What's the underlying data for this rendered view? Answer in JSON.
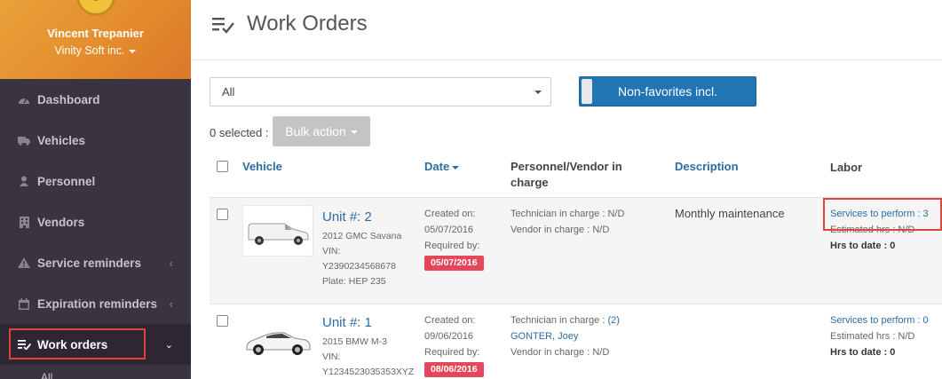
{
  "sidebar": {
    "user_name": "Vincent Trepanier",
    "company": "Vinity Soft inc.",
    "items": [
      {
        "label": "Dashboard",
        "icon": "dashboard-icon"
      },
      {
        "label": "Vehicles",
        "icon": "truck-icon"
      },
      {
        "label": "Personnel",
        "icon": "user-icon"
      },
      {
        "label": "Vendors",
        "icon": "building-icon"
      },
      {
        "label": "Service reminders",
        "icon": "warning-icon"
      },
      {
        "label": "Expiration reminders",
        "icon": "calendar-icon"
      },
      {
        "label": "Work orders",
        "icon": "checklist-icon"
      }
    ],
    "sub_all": "All"
  },
  "header": {
    "title": "Work Orders"
  },
  "filters": {
    "select_value": "All",
    "toggle_label": "Non-favorites incl."
  },
  "bulk": {
    "selected_text": "0 selected :",
    "button_label": "Bulk action"
  },
  "table": {
    "headers": {
      "vehicle": "Vehicle",
      "date": "Date",
      "personnel_line1": "Personnel/Vendor in",
      "personnel_line2": "charge",
      "description": "Description",
      "labor": "Labor"
    },
    "rows": [
      {
        "unit": "Unit #: 2",
        "model": "2012 GMC Savana",
        "vin_label": "VIN:",
        "vin": "Y2390234568678",
        "plate": "Plate: HEP 235",
        "created_label": "Created on:",
        "created": "05/07/2016",
        "required_label": "Required by:",
        "required": "05/07/2016",
        "technician": "Technician in charge : N/D",
        "vendor": "Vendor in charge : N/D",
        "description": "Monthly maintenance",
        "services": "Services to perform : 3",
        "estimated": "Estimated hrs : N/D",
        "hrs_to_date": "Hrs to date : 0"
      },
      {
        "unit": "Unit #: 1",
        "model": "2015 BMW M-3",
        "vin_label": "VIN:",
        "vin": "Y1234523035353XYZ",
        "created_label": "Created on:",
        "created": "09/06/2016",
        "required_label": "Required by:",
        "required": "08/06/2016",
        "technician_prefix": "Technician in charge : ",
        "technician_count": "(2)",
        "technician_name": "GONTER, Joey",
        "vendor": "Vendor in charge : N/D",
        "description": "",
        "services": "Services to perform : 0",
        "estimated": "Estimated hrs : N/D",
        "hrs_to_date": "Hrs to date : 0"
      }
    ]
  },
  "colors": {
    "sidebar_bg": "#3a3442",
    "profile_orange": "#e48a2c",
    "accent_blue": "#2275b4",
    "link_blue": "#2d6ca2",
    "badge_red": "#e5475a",
    "highlight_red": "#e0443f"
  }
}
